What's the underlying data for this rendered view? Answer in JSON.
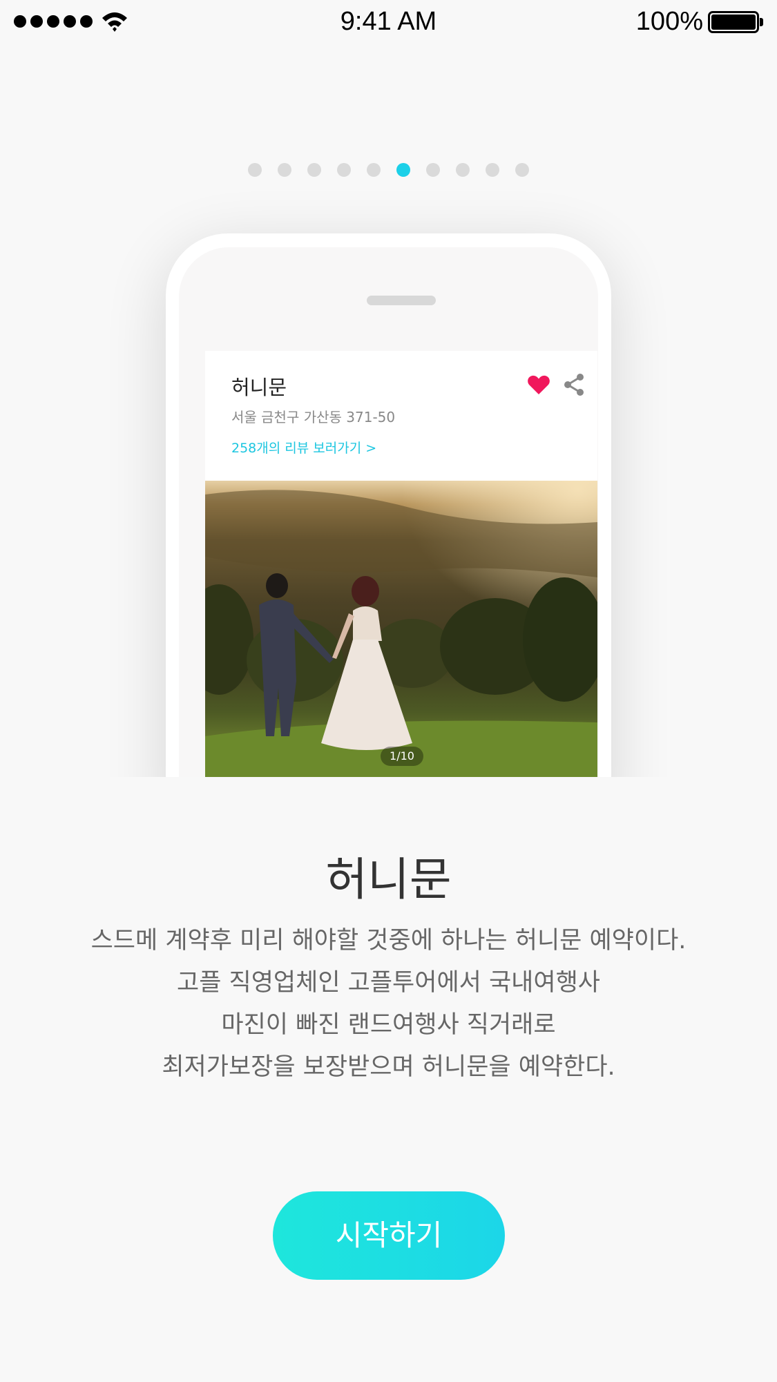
{
  "status_bar": {
    "time": "9:41 AM",
    "battery": "100%",
    "icons": [
      "signal-icon",
      "wifi-icon",
      "battery-icon"
    ]
  },
  "pager": {
    "count": 10,
    "active_index": 5,
    "active_color": "#1cd0e8",
    "inactive_color": "#dadada"
  },
  "card": {
    "title": "허니문",
    "address": "서울 금천구 가산동 371-50",
    "reviews_link": "258개의 리뷰 보러가기 >",
    "photo_counter": "1/10",
    "icons": [
      "heart-icon",
      "share-icon"
    ],
    "heart_color": "#f0185c"
  },
  "content": {
    "heading": "허니문",
    "description": [
      "스드메 계약후 미리 해야할 것중에 하나는 허니문 예약이다.",
      "고플 직영업체인 고플투어에서 국내여행사",
      "마진이 빠진 랜드여행사 직거래로",
      "최저가보장을 보장받으며 허니문을 예약한다."
    ]
  },
  "cta": {
    "label": "시작하기",
    "color": "#1cd6e8"
  }
}
